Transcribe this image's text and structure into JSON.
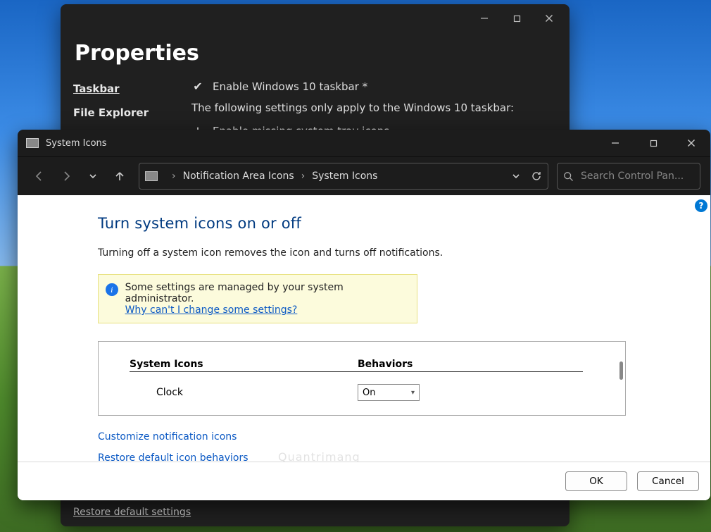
{
  "properties": {
    "title": "Properties",
    "nav": {
      "taskbar": "Taskbar",
      "file_explorer": "File Explorer"
    },
    "settings": {
      "enable_taskbar": "Enable Windows 10 taskbar *",
      "note": "The following settings only apply to the Windows 10 taskbar:",
      "enable_tray_icons": "Enable missing system tray icons"
    },
    "restore": "Restore default settings"
  },
  "system_icons": {
    "window_title": "System Icons",
    "breadcrumb": {
      "level1": "Notification Area Icons",
      "level2": "System Icons"
    },
    "search_placeholder": "Search Control Pan...",
    "page_title": "Turn system icons on or off",
    "page_desc": "Turning off a system icon removes the icon and turns off notifications.",
    "info_box": {
      "line1": "Some settings are managed by your system administrator.",
      "link": "Why can't I change some settings?"
    },
    "table": {
      "col_icons": "System Icons",
      "col_behaviors": "Behaviors",
      "rows": [
        {
          "name": "Clock",
          "value": "On"
        }
      ]
    },
    "links": {
      "customize": "Customize notification icons",
      "restore": "Restore default icon behaviors"
    },
    "footer": {
      "ok": "OK",
      "cancel": "Cancel"
    }
  },
  "watermark": "Quantrimang"
}
